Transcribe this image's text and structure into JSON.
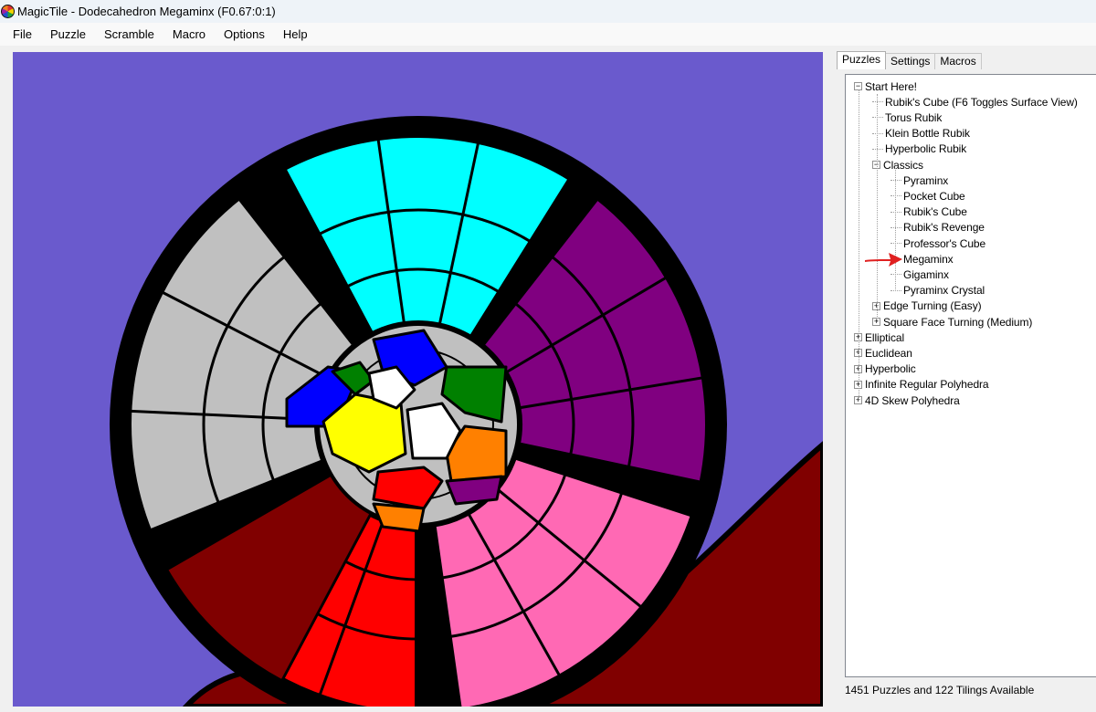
{
  "window": {
    "title": "MagicTile - Dodecahedron Megaminx (F0.67:0:1)",
    "app_icon": "magictile-icon"
  },
  "menu": [
    {
      "label": "File"
    },
    {
      "label": "Puzzle"
    },
    {
      "label": "Scramble"
    },
    {
      "label": "Macro"
    },
    {
      "label": "Options"
    },
    {
      "label": "Help"
    }
  ],
  "tabs": [
    {
      "label": "Puzzles",
      "active": true
    },
    {
      "label": "Settings",
      "active": false
    },
    {
      "label": "Macros",
      "active": false
    }
  ],
  "tree": [
    {
      "label": "Start Here!",
      "level": 0,
      "toggle": "expanded"
    },
    {
      "label": "Rubik's Cube (F6 Toggles Surface View)",
      "level": 1,
      "toggle": "none"
    },
    {
      "label": "Torus Rubik",
      "level": 1,
      "toggle": "none"
    },
    {
      "label": "Klein Bottle Rubik",
      "level": 1,
      "toggle": "none"
    },
    {
      "label": "Hyperbolic Rubik",
      "level": 1,
      "toggle": "none"
    },
    {
      "label": "Classics",
      "level": 1,
      "toggle": "expanded"
    },
    {
      "label": "Pyraminx",
      "level": 2,
      "toggle": "none"
    },
    {
      "label": "Pocket Cube",
      "level": 2,
      "toggle": "none"
    },
    {
      "label": "Rubik's Cube",
      "level": 2,
      "toggle": "none"
    },
    {
      "label": "Rubik's Revenge",
      "level": 2,
      "toggle": "none"
    },
    {
      "label": "Professor's Cube",
      "level": 2,
      "toggle": "none"
    },
    {
      "label": "Megaminx",
      "level": 2,
      "toggle": "none"
    },
    {
      "label": "Gigaminx",
      "level": 2,
      "toggle": "none"
    },
    {
      "label": "Pyraminx Crystal",
      "level": 2,
      "toggle": "none"
    },
    {
      "label": "Edge Turning (Easy)",
      "level": 1,
      "toggle": "collapsed"
    },
    {
      "label": "Square Face Turning (Medium)",
      "level": 1,
      "toggle": "collapsed"
    },
    {
      "label": "Elliptical",
      "level": 0,
      "toggle": "collapsed"
    },
    {
      "label": "Euclidean",
      "level": 0,
      "toggle": "collapsed"
    },
    {
      "label": "Hyperbolic",
      "level": 0,
      "toggle": "collapsed"
    },
    {
      "label": "Infinite Regular Polyhedra",
      "level": 0,
      "toggle": "collapsed"
    },
    {
      "label": "4D Skew Polyhedra",
      "level": 0,
      "toggle": "collapsed"
    }
  ],
  "toggle_glyphs": {
    "expanded": "−",
    "collapsed": "+"
  },
  "status": {
    "text": "1451 Puzzles and 122 Tilings Available"
  },
  "annotation": {
    "icon": "red-arrow-icon",
    "points_to": "Megaminx",
    "color": "#e02020"
  },
  "puzzle": {
    "background": "#6a5acd",
    "stickers": [
      {
        "color": "#00ffff",
        "name": "cyan"
      },
      {
        "color": "#800080",
        "name": "purple"
      },
      {
        "color": "#ff69b4",
        "name": "pink"
      },
      {
        "color": "#ff0000",
        "name": "red"
      },
      {
        "color": "#800000",
        "name": "maroon"
      },
      {
        "color": "#c0c0c0",
        "name": "silver"
      },
      {
        "color": "#0000ff",
        "name": "blue"
      },
      {
        "color": "#008000",
        "name": "green"
      },
      {
        "color": "#ffff00",
        "name": "yellow"
      },
      {
        "color": "#ffffff",
        "name": "white"
      },
      {
        "color": "#ff8000",
        "name": "orange"
      }
    ]
  }
}
